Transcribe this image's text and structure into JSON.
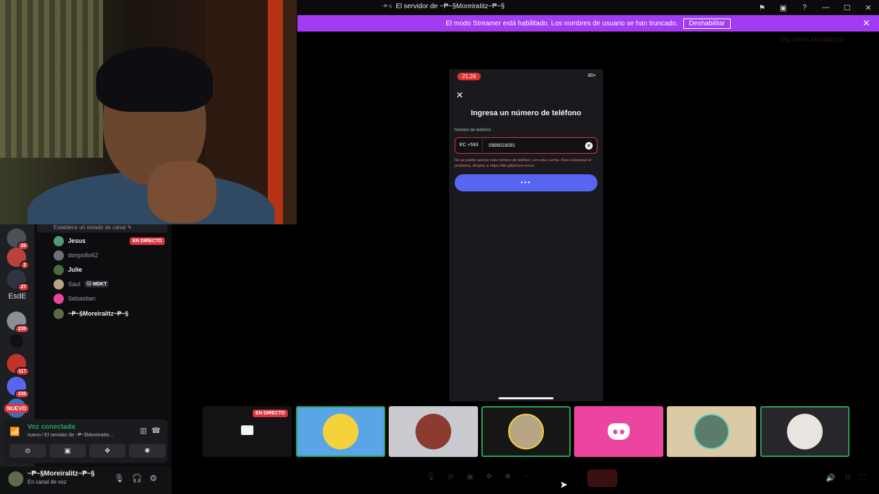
{
  "titlebar": {
    "title": "El servidor de ~₱~§MoreiraIitz~₱~§",
    "mini_label": "~₱~§",
    "icons": [
      "inbox-flag-icon",
      "screen-share-icon",
      "help-icon",
      "minimize-icon",
      "maximize-icon",
      "close-icon"
    ]
  },
  "banner": {
    "text": "El modo Streamer está habilitado. Los nombres de usuario se han truncado.",
    "button": "Deshabilitar",
    "close": "✕"
  },
  "servers": {
    "badges": [
      "26",
      "2",
      "27",
      "235",
      "117",
      "235"
    ],
    "text_server": "EsdE",
    "new_label": "NUEVO"
  },
  "channel": {
    "status_hint": "Establece un estado de canal ✎",
    "members": [
      {
        "name": "Jesus",
        "live": "EN DIRECTO"
      },
      {
        "name": "donpollo62"
      },
      {
        "name": "Julie"
      },
      {
        "name": "Saul",
        "tag": "🐱 MDKT"
      },
      {
        "name": "Sebastian"
      },
      {
        "name": "~₱~§MoreiraIitz~₱~§"
      }
    ]
  },
  "voice": {
    "connected": "Voz conectada",
    "subtitle": "nuevo / El servidor de ~₱~§MoreiraIitz...",
    "buttons": [
      "camera-off-icon",
      "screen-share-icon",
      "activities-icon",
      "soundboard-icon"
    ]
  },
  "user": {
    "name": "~₱~§MoreiraIitz~₱~§",
    "status": "En canal de voz"
  },
  "stage": {
    "resolution": "720p 30FPS",
    "live": "EN DIRECTO"
  },
  "phone": {
    "time": "21:24",
    "battery": "80+",
    "title": "Ingresa un número de teléfono",
    "field_label": "Número de teléfono",
    "country_code": "EC +593",
    "number": "0989018091",
    "error": "No se puede asociar este número de teléfono con esta cuenta. Para solucionar el problema, dirígete a: https://dis.gd/phone-errors",
    "button": "•••"
  },
  "tiles": {
    "live_label": "EN DIRECTO"
  }
}
